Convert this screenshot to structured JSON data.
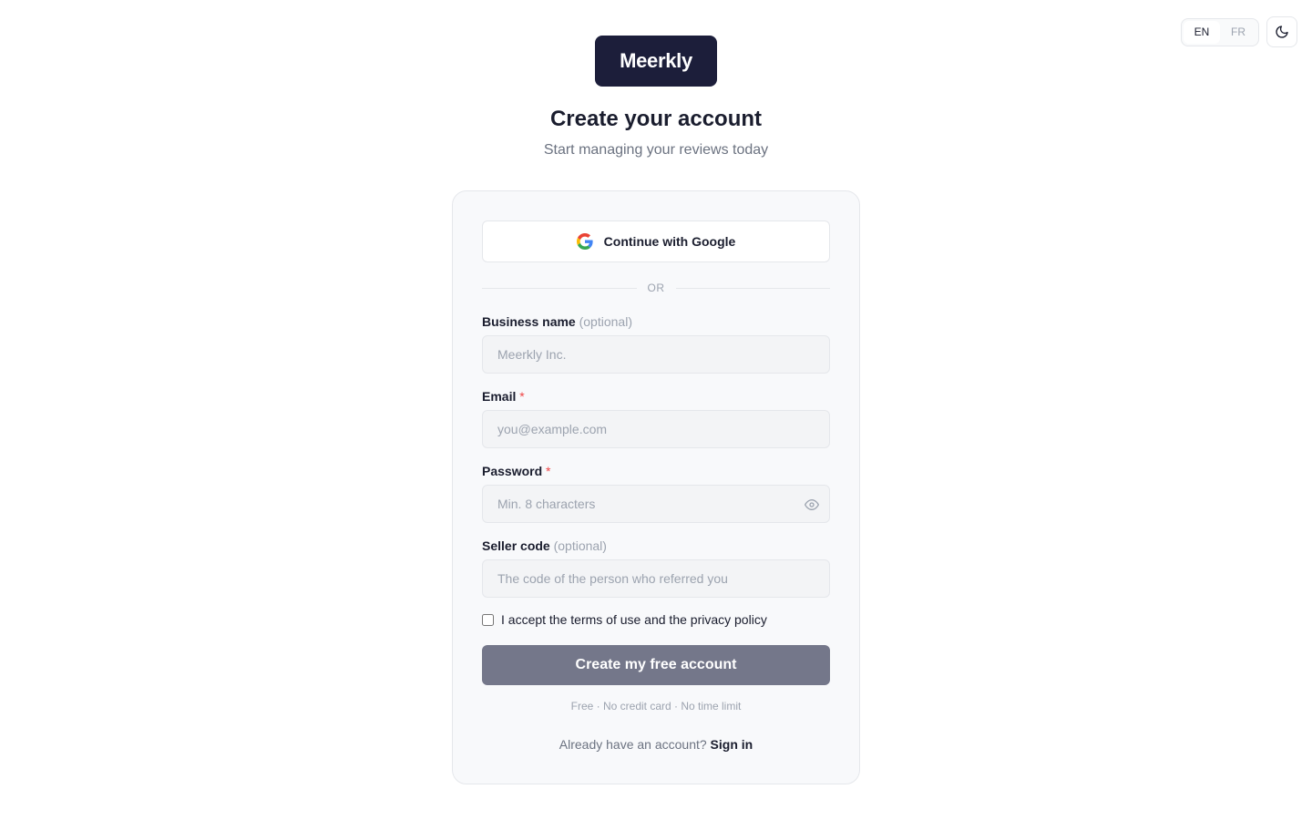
{
  "header": {
    "languages": [
      {
        "code": "EN",
        "active": true
      },
      {
        "code": "FR",
        "active": false
      }
    ],
    "theme_icon": "moon-icon"
  },
  "brand": {
    "logo_text": "Meerkly",
    "logo_bg": "#1c1e3a"
  },
  "page": {
    "title": "Create your account",
    "subtitle": "Start managing your reviews today"
  },
  "form": {
    "google_label": "Continue with Google",
    "google_icon": "google-icon",
    "divider_text": "OR",
    "fields": {
      "business": {
        "label": "Business name",
        "suffix": "(optional)",
        "placeholder": "Meerkly Inc.",
        "value": ""
      },
      "email": {
        "label": "Email",
        "suffix": "*",
        "placeholder": "you@example.com",
        "value": ""
      },
      "password": {
        "label": "Password",
        "suffix": "*",
        "placeholder": "Min. 8 characters",
        "value": "",
        "toggle_icon": "eye-icon"
      },
      "seller": {
        "label": "Seller code",
        "suffix": "(optional)",
        "placeholder": "The code of the person who referred you",
        "value": ""
      }
    },
    "terms_label": "I accept the terms of use and the privacy policy",
    "terms_checked": false,
    "submit_label": "Create my free account",
    "submit_color": "#74778a",
    "free_note": "Free · No credit card · No time limit",
    "signin_prompt": "Already have an account?",
    "signin_link": "Sign in"
  },
  "colors": {
    "required": "#ef4444",
    "muted": "#9ca3af",
    "text": "#1a1d2e"
  }
}
